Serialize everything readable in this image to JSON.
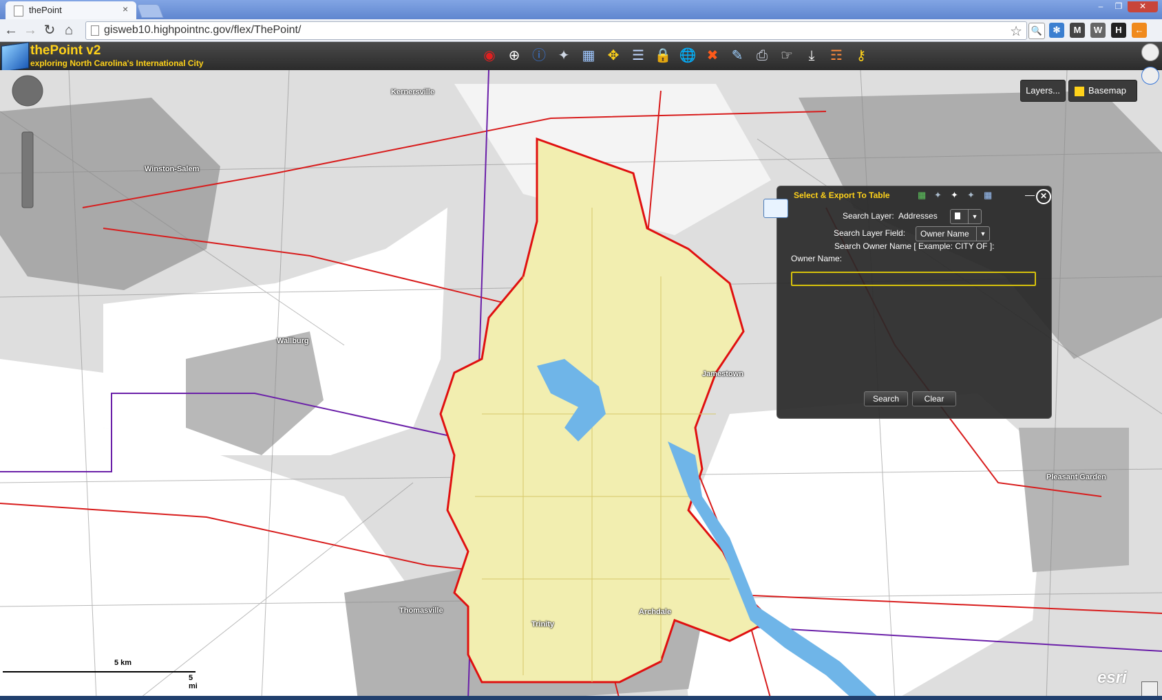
{
  "browser": {
    "tab_title": "thePoint",
    "tab_close": "×",
    "url": "gisweb10.highpointnc.gov/flex/ThePoint/",
    "window_controls": [
      "–",
      "❐",
      "✕"
    ]
  },
  "app": {
    "title": "thePoint v2",
    "subtitle": "exploring North Carolina's International City"
  },
  "map_buttons": {
    "layers": "Layers...",
    "basemap": "Basemap"
  },
  "places": [
    {
      "label": "Kernersville"
    },
    {
      "label": "Winston-Salem"
    },
    {
      "label": "Wallburg"
    },
    {
      "label": "Jamestown"
    },
    {
      "label": "Pleasant Garden"
    },
    {
      "label": "Thomasville"
    },
    {
      "label": "Archdale"
    },
    {
      "label": "Trinity"
    }
  ],
  "scale": {
    "top": "5 km",
    "bottom": "5 mi"
  },
  "attribution": "esri",
  "widget": {
    "title": "Select & Export To Table",
    "search_layer_label": "Search Layer:",
    "search_layer_value": "Addresses",
    "search_field_label": "Search Layer Field:",
    "search_field_value": "Owner Name",
    "example_text": "Search Owner Name [ Example: CITY OF ]:",
    "owner_label": "Owner Name:",
    "owner_value": "",
    "search_button": "Search",
    "clear_button": "Clear"
  },
  "colors": {
    "header_text": "#ffd21a",
    "city_fill": "#f2eeb0",
    "city_border": "#e01010",
    "water": "#6fb5e8",
    "county_line": "#6a1fa8"
  }
}
